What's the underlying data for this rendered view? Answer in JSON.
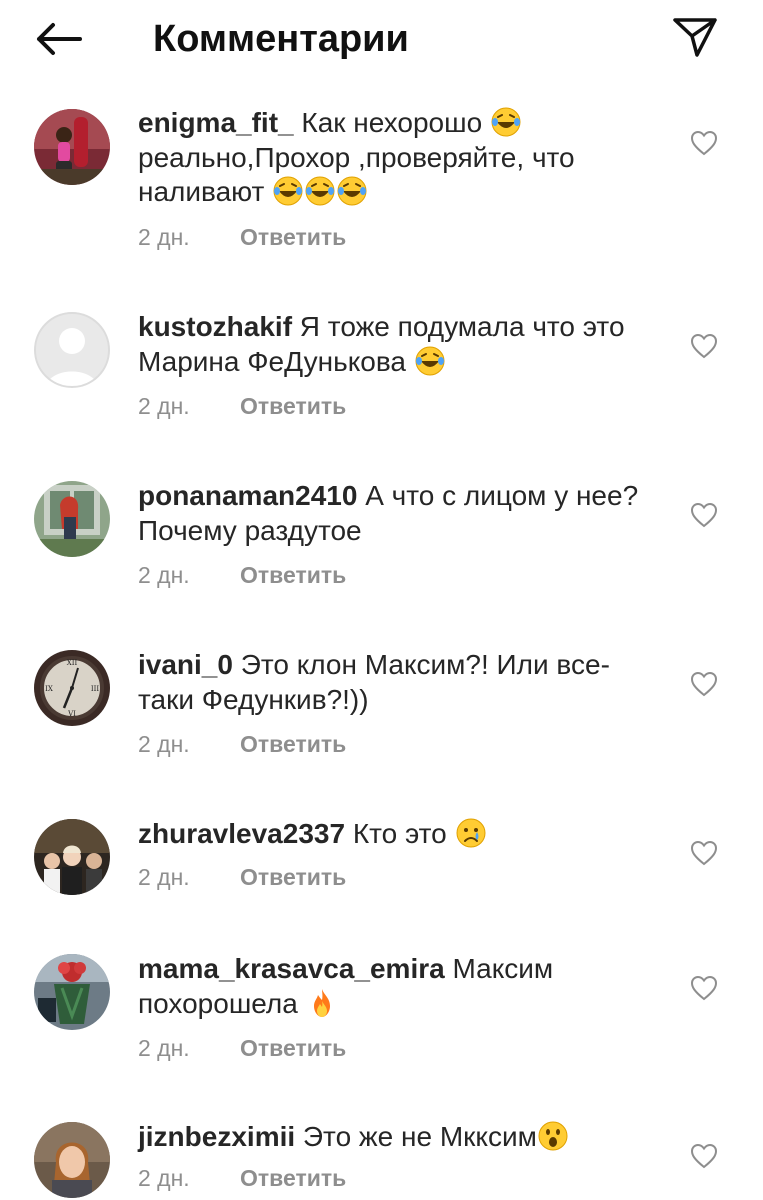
{
  "header": {
    "title": "Комментарии",
    "back_icon": "arrow-left-icon",
    "send_icon": "paper-plane-icon"
  },
  "comments": [
    {
      "username": "enigma_fit_",
      "text": "Как нехорошо 😂 реально,Прохор ,проверяйте, что наливают 😂😂😂",
      "time": "2 дн.",
      "reply": "Ответить"
    },
    {
      "username": "kustozhakif",
      "text": "Я тоже подумала что это Марина ФеДунькова 😂",
      "time": "2 дн.",
      "reply": "Ответить"
    },
    {
      "username": "ponanaman2410",
      "text": "А что с лицом у нее? Почему раздутое",
      "time": "2 дн.",
      "reply": "Ответить"
    },
    {
      "username": "ivani_0",
      "text": "Это клон Максим?! Или все-таки Федункив?!))",
      "time": "2 дн.",
      "reply": "Ответить"
    },
    {
      "username": "zhuravleva2337",
      "text": "Кто это 😢",
      "time": "2 дн.",
      "reply": "Ответить"
    },
    {
      "username": "mama_krasavca_emira",
      "text": "Максим похорошела 🔥",
      "time": "2 дн.",
      "reply": "Ответить"
    },
    {
      "username": "jiznbezximii",
      "text": "Это же не Мкксим😮",
      "time": "2 дн.",
      "reply": "Ответить"
    }
  ],
  "colors": {
    "text": "#262626",
    "meta": "#8e8e8e",
    "background": "#ffffff"
  }
}
